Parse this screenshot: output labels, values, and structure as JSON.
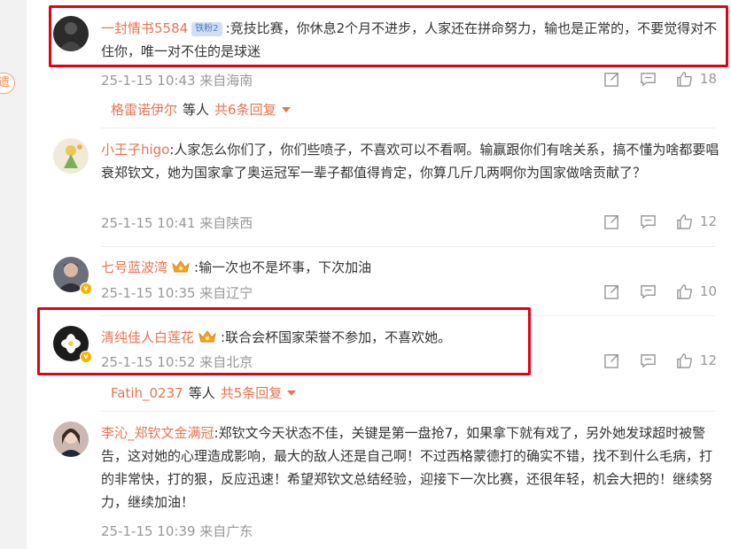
{
  "sidebar": {
    "badge_text": "遗"
  },
  "comments": [
    {
      "username": "一封情书5584",
      "badge": "铁粉2",
      "text": ":竞技比赛，你休息2个月不进步，人家还在拼命努力，输也是正常的，不要觉得对不住你，唯一对不住的是球迷",
      "time": "25-1-15 10:43 来自海南",
      "likes": "18"
    },
    {
      "username": "小王子higo",
      "text": ":人家怎么你们了，你们些喷子，不喜欢可以不看啊。输赢跟你们有啥关系，搞不懂为啥都要唱衰郑钦文，她为国家拿了奥运冠军一辈子都值得肯定，你算几斤几两啊你为国家做啥贡献了？",
      "time": "25-1-15 10:41 来自陕西",
      "likes": "12"
    },
    {
      "username": "七号蓝波湾",
      "text": ":输一次也不是坏事，下次加油",
      "time": "25-1-15 10:35 来自辽宁",
      "likes": "10"
    },
    {
      "username": "清纯佳人白莲花",
      "text": ":联合会杯国家荣誉不参加，不喜欢她。",
      "time": "25-1-15 10:52 来自北京",
      "likes": "12"
    },
    {
      "username": "李沁_郑钦文金满冠",
      "text": ":郑钦文今天状态不佳，关键是第一盘抢7，如果拿下就有戏了，另外她发球超时被警告，这对她的心理造成影响，最大的敌人还是自己啊！不过西格蒙德打的确实不错，找不到什么毛病，打的非常快，打的狠，反应迅速！希望郑钦文总结经验，迎接下一次比赛，还很年轻，机会大把的！继续努力，继续加油！",
      "time": "25-1-15 10:39 来自广东"
    }
  ],
  "reply_threads": [
    {
      "who": "格雷诺伊尔",
      "etc": "等人",
      "more": "共6条回复"
    },
    {
      "who": "Fatih_0237",
      "etc": "等人",
      "more": "共5条回复"
    }
  ],
  "colors": {
    "username": "#eb7350",
    "highlight": "#e60012",
    "meta": "#999999"
  }
}
